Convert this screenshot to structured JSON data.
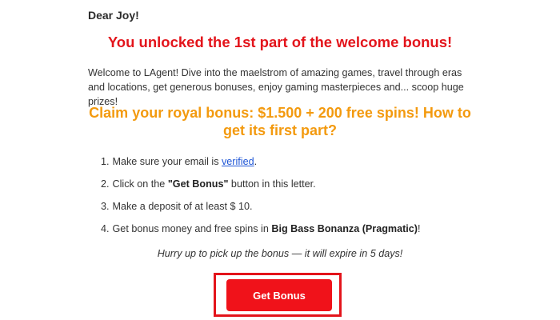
{
  "greeting": "Dear Joy!",
  "headline": "You unlocked the 1st part of the welcome bonus!",
  "intro": "Welcome to LAgent! Dive into the maelstrom of amazing games, travel through eras and locations, get generous bonuses, enjoy gaming masterpieces and... scoop huge prizes!",
  "claim_title": "Claim your royal bonus: $1.500 + 200 free spins! How to get its first part?",
  "steps": [
    {
      "num": "1.",
      "before": "Make sure your email is ",
      "link": "verified",
      "after": "."
    },
    {
      "num": "2.",
      "before": "Click on the ",
      "bold": "\"Get Bonus\"",
      "after": " button in this letter."
    },
    {
      "num": "3.",
      "text": "Make a deposit of at least $ 10."
    },
    {
      "num": "4.",
      "before": "Get bonus money and free spins in ",
      "bold": "Big Bass Bonanza (Pragmatic)",
      "after": "!"
    }
  ],
  "hurry_text": "Hurry up to pick up the bonus — it will expire in 5 days!",
  "cta_label": "Get Bonus",
  "colors": {
    "headline_red": "#e3141b",
    "claim_orange": "#f39a0f",
    "button_red": "#f0121a",
    "link_blue": "#1f56d6"
  }
}
